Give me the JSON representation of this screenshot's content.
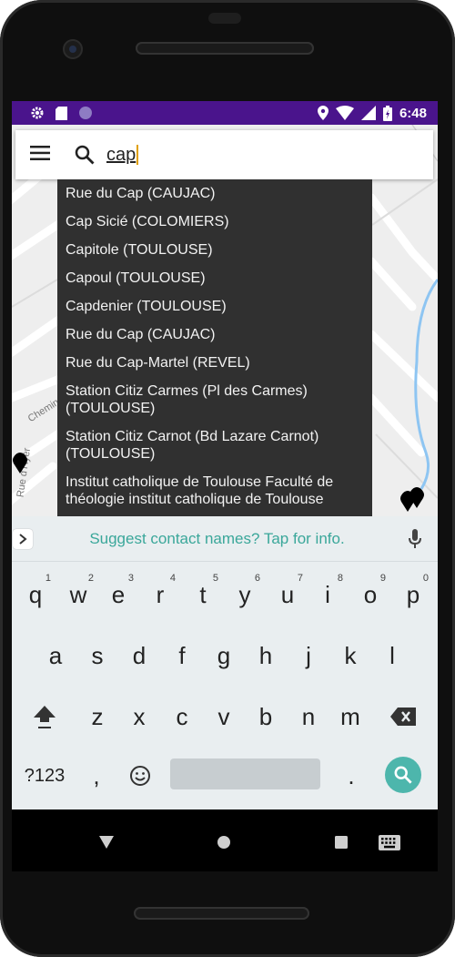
{
  "status_bar": {
    "time": "6:48",
    "left_icons": [
      "gear-icon",
      "sd-card-icon",
      "circle-icon"
    ],
    "right_icons": [
      "location-icon",
      "wifi-icon",
      "signal-icon",
      "battery-icon"
    ]
  },
  "search": {
    "query": "cap"
  },
  "map": {
    "street_labels": [
      "Chemin",
      "Rue d'Hyèr"
    ]
  },
  "suggestions": [
    "Rue du Cap (CAUJAC)",
    "Cap Sicié (COLOMIERS)",
    "Capitole (TOULOUSE)",
    "Capoul (TOULOUSE)",
    "Capdenier (TOULOUSE)",
    "Rue du Cap (CAUJAC)",
    "Rue du Cap-Martel (REVEL)",
    "Station Citiz Carmes (Pl des Carmes) (TOULOUSE)",
    "Station Citiz Carnot (Bd Lazare Carnot) (TOULOUSE)",
    "Institut catholique de Toulouse Faculté de théologie institut catholique de Toulouse"
  ],
  "keyboard": {
    "suggestion_text": "Suggest contact names? Tap for info.",
    "row1": [
      {
        "key": "q",
        "hint": "1"
      },
      {
        "key": "w",
        "hint": "2"
      },
      {
        "key": "e",
        "hint": "3"
      },
      {
        "key": "r",
        "hint": "4"
      },
      {
        "key": "t",
        "hint": "5"
      },
      {
        "key": "y",
        "hint": "6"
      },
      {
        "key": "u",
        "hint": "7"
      },
      {
        "key": "i",
        "hint": "8"
      },
      {
        "key": "o",
        "hint": "9"
      },
      {
        "key": "p",
        "hint": "0"
      }
    ],
    "row2": [
      "a",
      "s",
      "d",
      "f",
      "g",
      "h",
      "j",
      "k",
      "l"
    ],
    "row3": [
      "z",
      "x",
      "c",
      "v",
      "b",
      "n",
      "m"
    ],
    "symbols_label": "?123",
    "comma": ",",
    "period": "."
  },
  "colors": {
    "status_bar": "#4a148c",
    "suggestion_bg": "#303030",
    "accent_teal": "#4db6ac",
    "keyboard_bg": "#e9eef0"
  }
}
